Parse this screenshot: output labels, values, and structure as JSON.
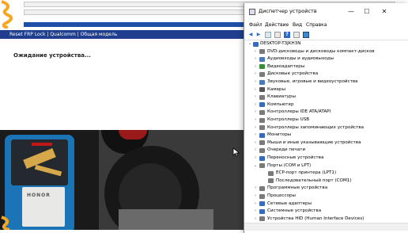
{
  "tool": {
    "banner": "Reset FRP Lock | Qualcomm | Общая модель",
    "status": "Ожидание устройства...",
    "progress_fraction": 1.0
  },
  "photo": {
    "phone_brand": "HONOR"
  },
  "device_manager": {
    "title": "Диспетчер устройств",
    "window_buttons": {
      "minimize": "—",
      "maximize": "☐",
      "close": "✕"
    },
    "menu": [
      "Файл",
      "Действие",
      "Вид",
      "Справка"
    ],
    "toolbar_icons": [
      "back-arrow-icon",
      "forward-arrow-icon",
      "properties-icon",
      "list-icon",
      "help-icon",
      "view-icon",
      "monitor-icon"
    ],
    "root": "DESKTOP-T3JKH3N",
    "categories": [
      {
        "label": "DVD-дисководы и дисководы компакт-дисков",
        "expanded": false,
        "icon_color": "#7a7a7a"
      },
      {
        "label": "Аудиовходы и аудиовыходы",
        "expanded": false,
        "icon_color": "#4a7ab8"
      },
      {
        "label": "Видеоадаптеры",
        "expanded": false,
        "icon_color": "#3a8a3a"
      },
      {
        "label": "Дисковые устройства",
        "expanded": false,
        "icon_color": "#7a7a7a"
      },
      {
        "label": "Звуковые, игровые и видеоустройства",
        "expanded": false,
        "icon_color": "#4a7ab8"
      },
      {
        "label": "Камеры",
        "expanded": false,
        "icon_color": "#555555"
      },
      {
        "label": "Клавиатуры",
        "expanded": false,
        "icon_color": "#7a7a7a"
      },
      {
        "label": "Компьютер",
        "expanded": false,
        "icon_color": "#3a6ac0"
      },
      {
        "label": "Контроллеры IDE ATA/ATAPI",
        "expanded": false,
        "icon_color": "#7a7a7a"
      },
      {
        "label": "Контроллеры USB",
        "expanded": false,
        "icon_color": "#7a7a7a"
      },
      {
        "label": "Контроллеры запоминающих устройства",
        "expanded": false,
        "icon_color": "#7a7a7a"
      },
      {
        "label": "Мониторы",
        "expanded": false,
        "icon_color": "#3a6ac0"
      },
      {
        "label": "Мыши и иные указывающие устройства",
        "expanded": false,
        "icon_color": "#7a7a7a"
      },
      {
        "label": "Очереди печати",
        "expanded": false,
        "icon_color": "#7a7a7a"
      },
      {
        "label": "Переносные устройства",
        "expanded": false,
        "icon_color": "#3a6ac0"
      },
      {
        "label": "Порты (COM и LPT)",
        "expanded": true,
        "icon_color": "#7a7a7a",
        "children": [
          "ECP-порт принтера (LPT1)",
          "Последовательный порт (COM1)"
        ]
      },
      {
        "label": "Программные устройства",
        "expanded": false,
        "icon_color": "#7a7a7a"
      },
      {
        "label": "Процессоры",
        "expanded": false,
        "icon_color": "#7a7a7a"
      },
      {
        "label": "Сетевые адаптеры",
        "expanded": false,
        "icon_color": "#3a6ac0"
      },
      {
        "label": "Системные устройства",
        "expanded": false,
        "icon_color": "#3a6ac0"
      },
      {
        "label": "Устройства HID (Human Interface Devices)",
        "expanded": false,
        "icon_color": "#7a7a7a"
      }
    ]
  },
  "colors": {
    "banner_bg": "#1f3f8e",
    "progress": "#1e4fa8",
    "accent_orange": "#f5a623"
  }
}
